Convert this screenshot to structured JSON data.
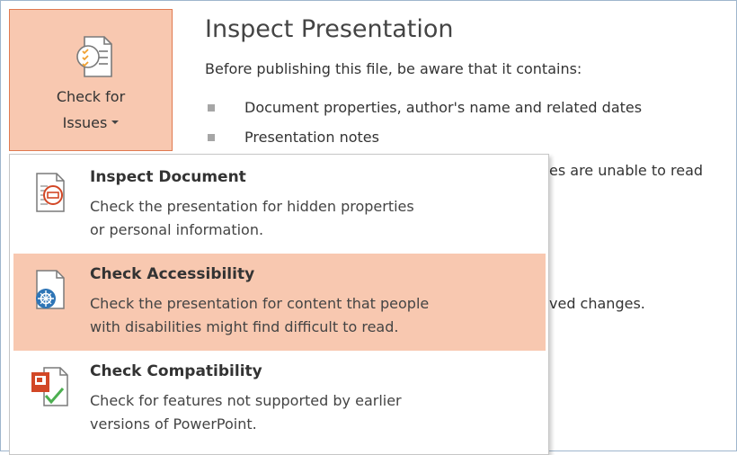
{
  "check_for_issues": {
    "line1": "Check for",
    "line2": "Issues",
    "icon": "checklist-icon"
  },
  "inspect_panel": {
    "title": "Inspect Presentation",
    "intro": "Before publishing this file, be aware that it contains:",
    "bullets": [
      "Document properties, author's name and related dates",
      "Presentation notes"
    ],
    "partial_text_1": "es are unable to read",
    "partial_text_2": "ved changes."
  },
  "menu": {
    "items": [
      {
        "title": "Inspect Document",
        "desc_line1": "Check the presentation for hidden properties",
        "desc_line2": "or personal information.",
        "icon": "inspect-document-icon",
        "active": false
      },
      {
        "title": "Check Accessibility",
        "desc_line1": "Check the presentation for content that people",
        "desc_line2": "with disabilities might find difficult to read.",
        "icon": "accessibility-icon",
        "active": true
      },
      {
        "title": "Check Compatibility",
        "desc_line1": "Check for features not supported by earlier",
        "desc_line2": "versions of PowerPoint.",
        "icon": "compatibility-icon",
        "active": false
      }
    ]
  },
  "colors": {
    "highlight": "#f8c8b0",
    "highlight_border": "#e07a50",
    "accent_blue": "#2e75b6",
    "accent_red": "#d24726",
    "check_green": "#4caf50"
  }
}
